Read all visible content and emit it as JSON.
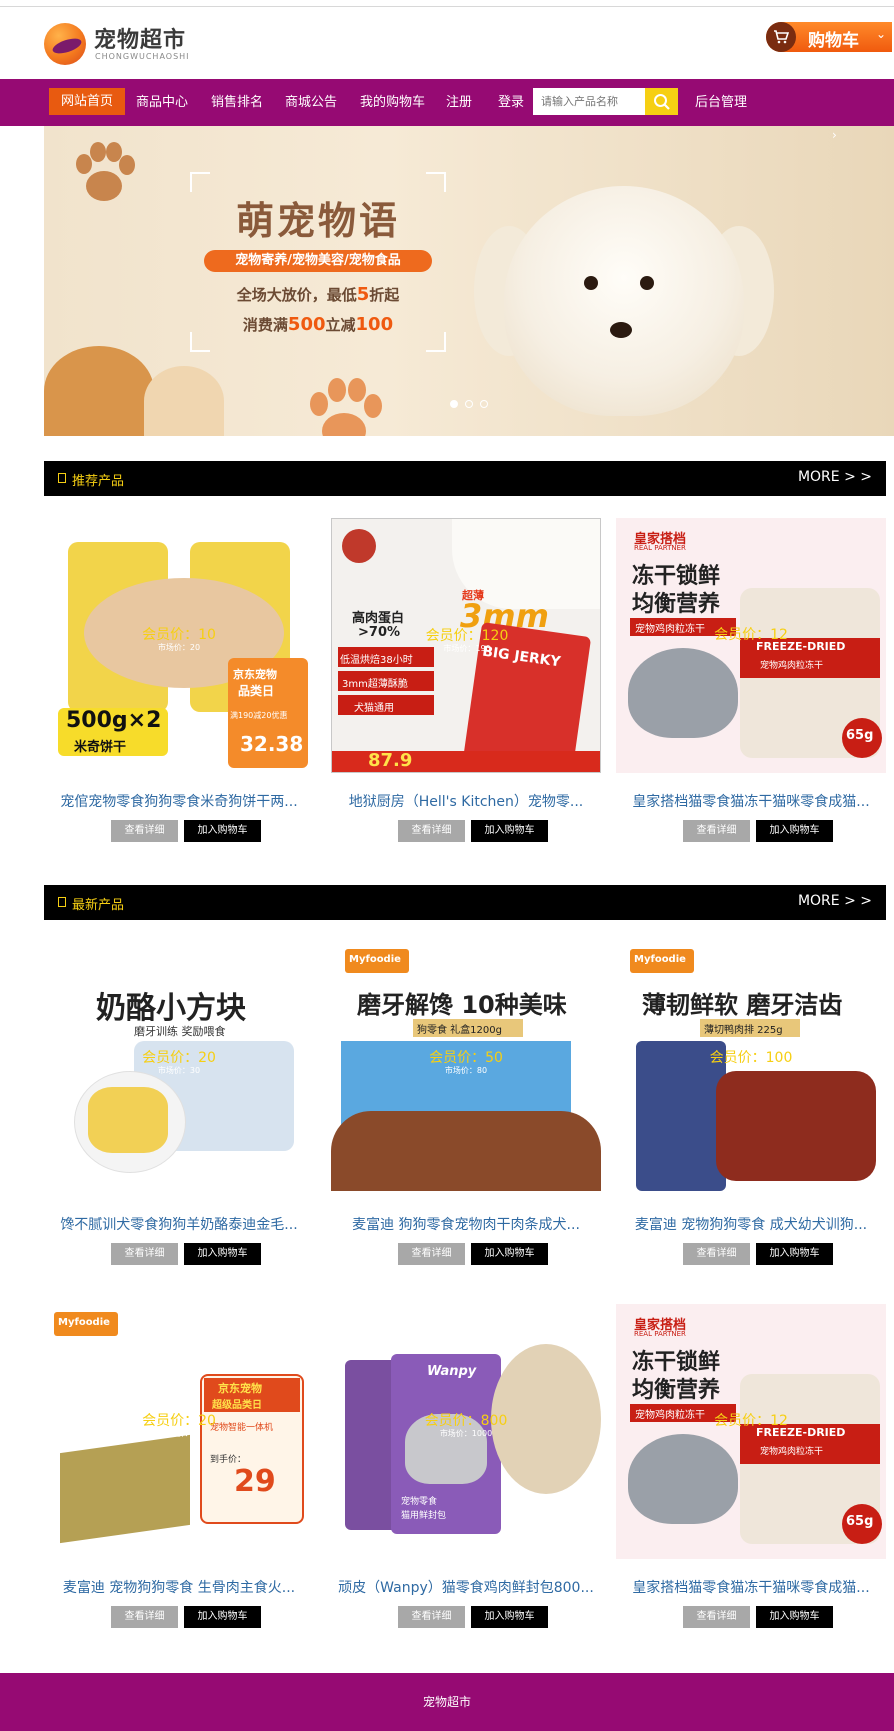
{
  "header": {
    "logo_name": "宠物超市",
    "logo_sub": "CHONGWUCHAOSHI",
    "cart_label": "购物车",
    "cart_arrow": "⌄"
  },
  "nav": {
    "items": [
      {
        "label": "网站首页"
      },
      {
        "label": "商品中心"
      },
      {
        "label": "销售排名"
      },
      {
        "label": "商城公告"
      },
      {
        "label": "我的购物车"
      },
      {
        "label": "注册"
      },
      {
        "label": "登录"
      }
    ],
    "search_placeholder": "请输入产品名称",
    "admin": "后台管理"
  },
  "banner": {
    "title": "萌宠物语",
    "pill": "宠物寄养/宠物美容/宠物食品",
    "line1_a": "全场大放价，最低",
    "line1_b": "5",
    "line1_c": "折起",
    "line2_a": "消费满",
    "line2_b": "500",
    "line2_c": "立减",
    "line2_d": "100",
    "next": "›"
  },
  "sections": {
    "recommended": {
      "title": "推荐产品",
      "more": "MORE > >"
    },
    "latest": {
      "title": "最新产品",
      "more": "MORE > >"
    }
  },
  "buttons": {
    "detail": "查看详细",
    "add_cart": "加入购物车"
  },
  "products": [
    {
      "name": "宠倌宠物零食狗狗零食米奇狗饼干两...",
      "member": "会员价：10",
      "market": "市场价：20",
      "art": {
        "big": "500g×2",
        "big_sub": "米奇饼干",
        "tag": "京东宠物",
        "tag_sub": "品类日",
        "deal": "满190减20优惠",
        "price": "32.38"
      }
    },
    {
      "name": "地狱厨房（Hell's Kitchen）宠物零...",
      "member": "会员价：120",
      "market": "市场价：190",
      "art": {
        "badge": "3mm",
        "badge_pre": "超薄",
        "l1": "高肉蛋白",
        "l2": ">70%",
        "l3": "低温烘焙38小时",
        "l4": "3mm超薄酥脆",
        "l5": "犬猫通用",
        "pack": "BIG JERKY",
        "price": "87.9"
      }
    },
    {
      "name": "皇家搭档猫零食猫冻干猫咪零食成猫...",
      "member": "会员价：12",
      "market": "",
      "art": {
        "brand": "皇家搭档",
        "brand_en": "REAL PARTNER",
        "t1": "冻干锁鲜",
        "t2": "均衡营养",
        "tag": "宠物鸡肉粒冻干",
        "jar": "FREEZE-DRIED",
        "jar_sub": "宠物鸡肉粒冻干",
        "g": "65g"
      }
    },
    {
      "name": "馋不腻训犬零食狗狗羊奶酪泰迪金毛...",
      "member": "会员价：20",
      "market": "市场价：30",
      "art": {
        "t1": "奶酪小方块",
        "t2": "磨牙训练 奖励喂食"
      }
    },
    {
      "name": "麦富迪 狗狗零食宠物肉干肉条成犬...",
      "member": "会员价：50",
      "market": "市场价：80",
      "art": {
        "brand": "Myfoodie",
        "t1": "磨牙解馋 10种美味",
        "t2": "狗零食 礼盒1200g"
      }
    },
    {
      "name": "麦富迪 宠物狗狗零食 成犬幼犬训狗...",
      "member": "会员价：100",
      "market": "",
      "art": {
        "brand": "Myfoodie",
        "t1": "薄韧鲜软 磨牙洁齿",
        "t2": "薄切鸭肉排 225g"
      }
    },
    {
      "name": "麦富迪 宠物狗狗零食 生骨肉主食火...",
      "member": "会员价：20",
      "market": "市场价：3",
      "art": {
        "brand": "Myfoodie",
        "tag": "京东宠物",
        "tag_sub": "超级品类日",
        "deal": "宠物智能一体机",
        "price": "29",
        "price_pre": "到手价："
      }
    },
    {
      "name": "顽皮（Wanpy）猫零食鸡肉鲜封包800...",
      "member": "会员价：800",
      "market": "市场价：1000",
      "art": {
        "brand": "Wanpy",
        "t1": "宠物零食",
        "t2": "猫用鲜封包"
      }
    },
    {
      "name": "皇家搭档猫零食猫冻干猫咪零食成猫...",
      "member": "会员价：12",
      "market": "",
      "art": {
        "brand": "皇家搭档",
        "brand_en": "REAL PARTNER",
        "t1": "冻干锁鲜",
        "t2": "均衡营养",
        "tag": "宠物鸡肉粒冻干",
        "jar": "FREEZE-DRIED",
        "jar_sub": "宠物鸡肉粒冻干",
        "g": "65g"
      }
    }
  ],
  "footer": {
    "text": "宠物超市"
  }
}
